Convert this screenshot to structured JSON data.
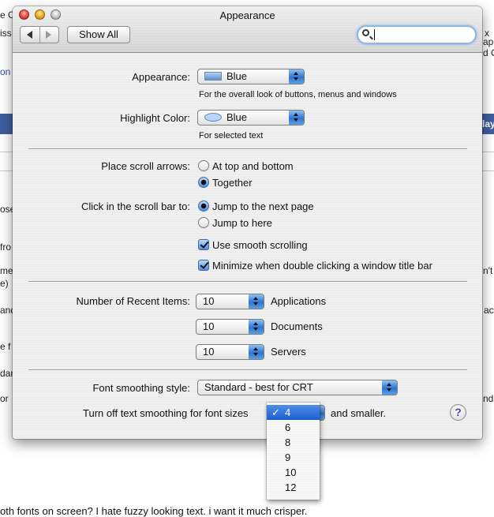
{
  "background_page": {
    "fragments_left": [
      "e C",
      "iss",
      "on",
      "ose",
      "fro",
      "me",
      "e)",
      "and",
      "e f",
      "dar",
      "or"
    ],
    "fragments_right": [
      "x",
      "ap",
      "d C",
      "lay",
      "n't",
      "ac",
      "nd"
    ],
    "bottom_text": "oth fonts on screen? I hate fuzzy looking text. i want it much crisper."
  },
  "window": {
    "title": "Appearance",
    "toolbar": {
      "show_all_label": "Show All",
      "search_placeholder": ""
    }
  },
  "appearance": {
    "appearance_label": "Appearance:",
    "appearance_value": "Blue",
    "appearance_hint": "For the overall look of buttons, menus and windows",
    "highlight_label": "Highlight Color:",
    "highlight_value": "Blue",
    "highlight_hint": "For selected text"
  },
  "scrolling": {
    "scroll_arrows_label": "Place scroll arrows:",
    "scroll_arrows_options": [
      "At top and bottom",
      "Together"
    ],
    "scroll_arrows_selected": "Together",
    "click_label": "Click in the scroll bar to:",
    "click_options": [
      "Jump to the next page",
      "Jump to here"
    ],
    "click_selected": "Jump to the next page",
    "smooth_scrolling_label": "Use smooth scrolling",
    "smooth_scrolling_checked": true,
    "minimize_label": "Minimize when double clicking a window title bar",
    "minimize_checked": true
  },
  "recent_items": {
    "label": "Number of Recent Items:",
    "rows": [
      {
        "value": "10",
        "name": "Applications"
      },
      {
        "value": "10",
        "name": "Documents"
      },
      {
        "value": "10",
        "name": "Servers"
      }
    ]
  },
  "font_smoothing": {
    "style_label": "Font smoothing style:",
    "style_value": "Standard - best for CRT",
    "turn_off_label": "Turn off text smoothing for font sizes",
    "turn_off_suffix": "and smaller.",
    "menu_options": [
      "4",
      "6",
      "8",
      "9",
      "10",
      "12"
    ],
    "menu_selected": "4",
    "check_mark": "✓"
  },
  "help_label": "?",
  "colors": {
    "accent_blue": "#2f74d0",
    "menu_selection": "#1c5fd0"
  }
}
